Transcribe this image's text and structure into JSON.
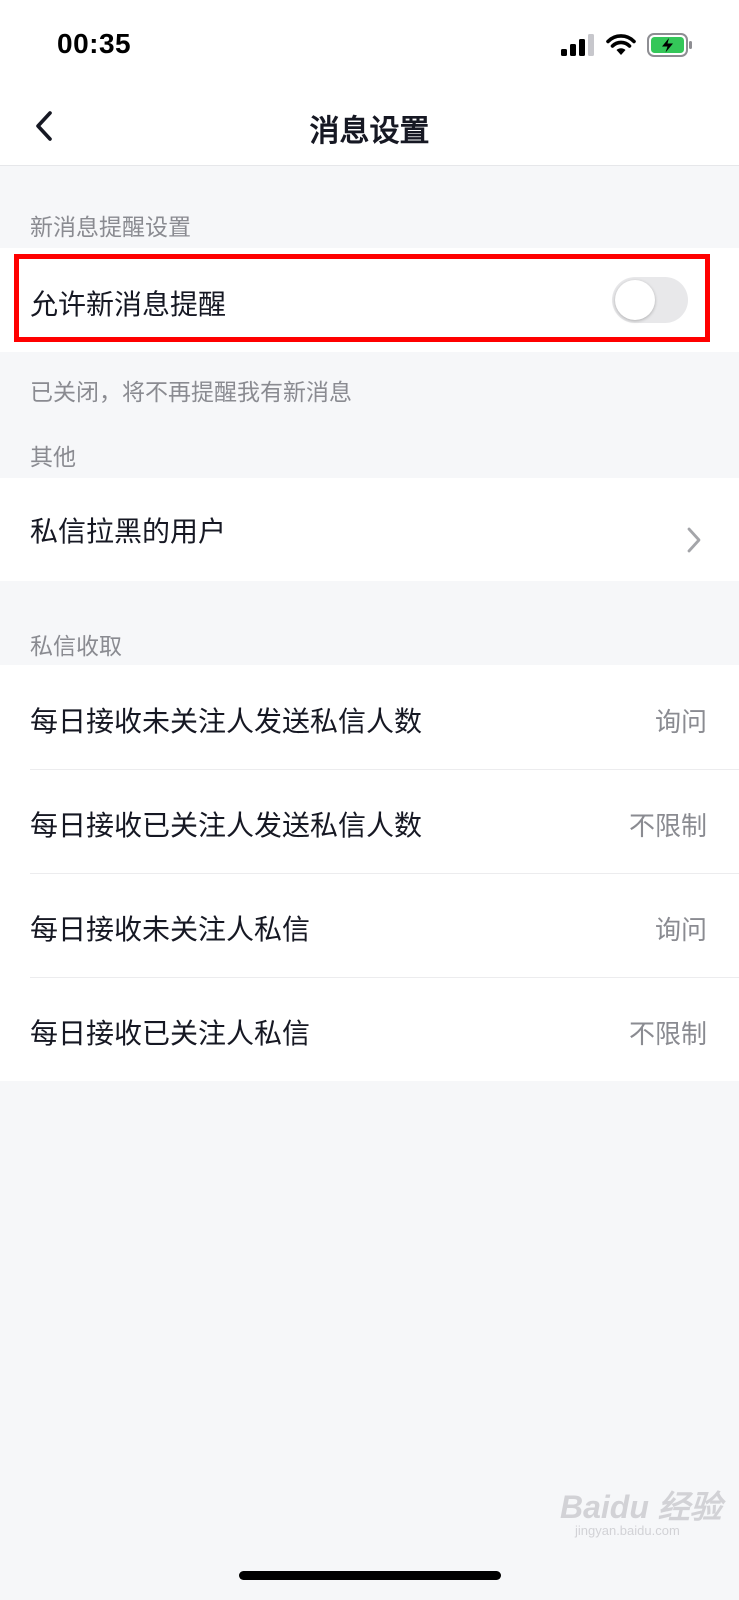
{
  "status_bar": {
    "time": "00:35",
    "icons": [
      "cellular-signal-icon",
      "wifi-icon",
      "battery-charging-icon"
    ]
  },
  "nav": {
    "title": "消息设置",
    "back_icon": "chevron-left-icon"
  },
  "sections": {
    "new_message": {
      "header": "新消息提醒设置",
      "allow_label": "允许新消息提醒",
      "allow_enabled": false,
      "footnote": "已关闭，将不再提醒我有新消息"
    },
    "other": {
      "header": "其他",
      "blocked_users_label": "私信拉黑的用户"
    },
    "dm_receive": {
      "header": "私信收取",
      "rows": [
        {
          "label": "每日接收未关注人发送私信人数",
          "value": "询问"
        },
        {
          "label": "每日接收已关注人发送私信人数",
          "value": "不限制"
        },
        {
          "label": "每日接收未关注人私信",
          "value": "询问"
        },
        {
          "label": "每日接收已关注人私信",
          "value": "不限制"
        }
      ]
    }
  },
  "watermark": {
    "text": "Baidu 经验",
    "sub": "jingyan.baidu.com"
  },
  "colors": {
    "highlight": "#ff0000",
    "toggle_off": "#e8e8ea",
    "secondary_text": "#8a8b91"
  }
}
